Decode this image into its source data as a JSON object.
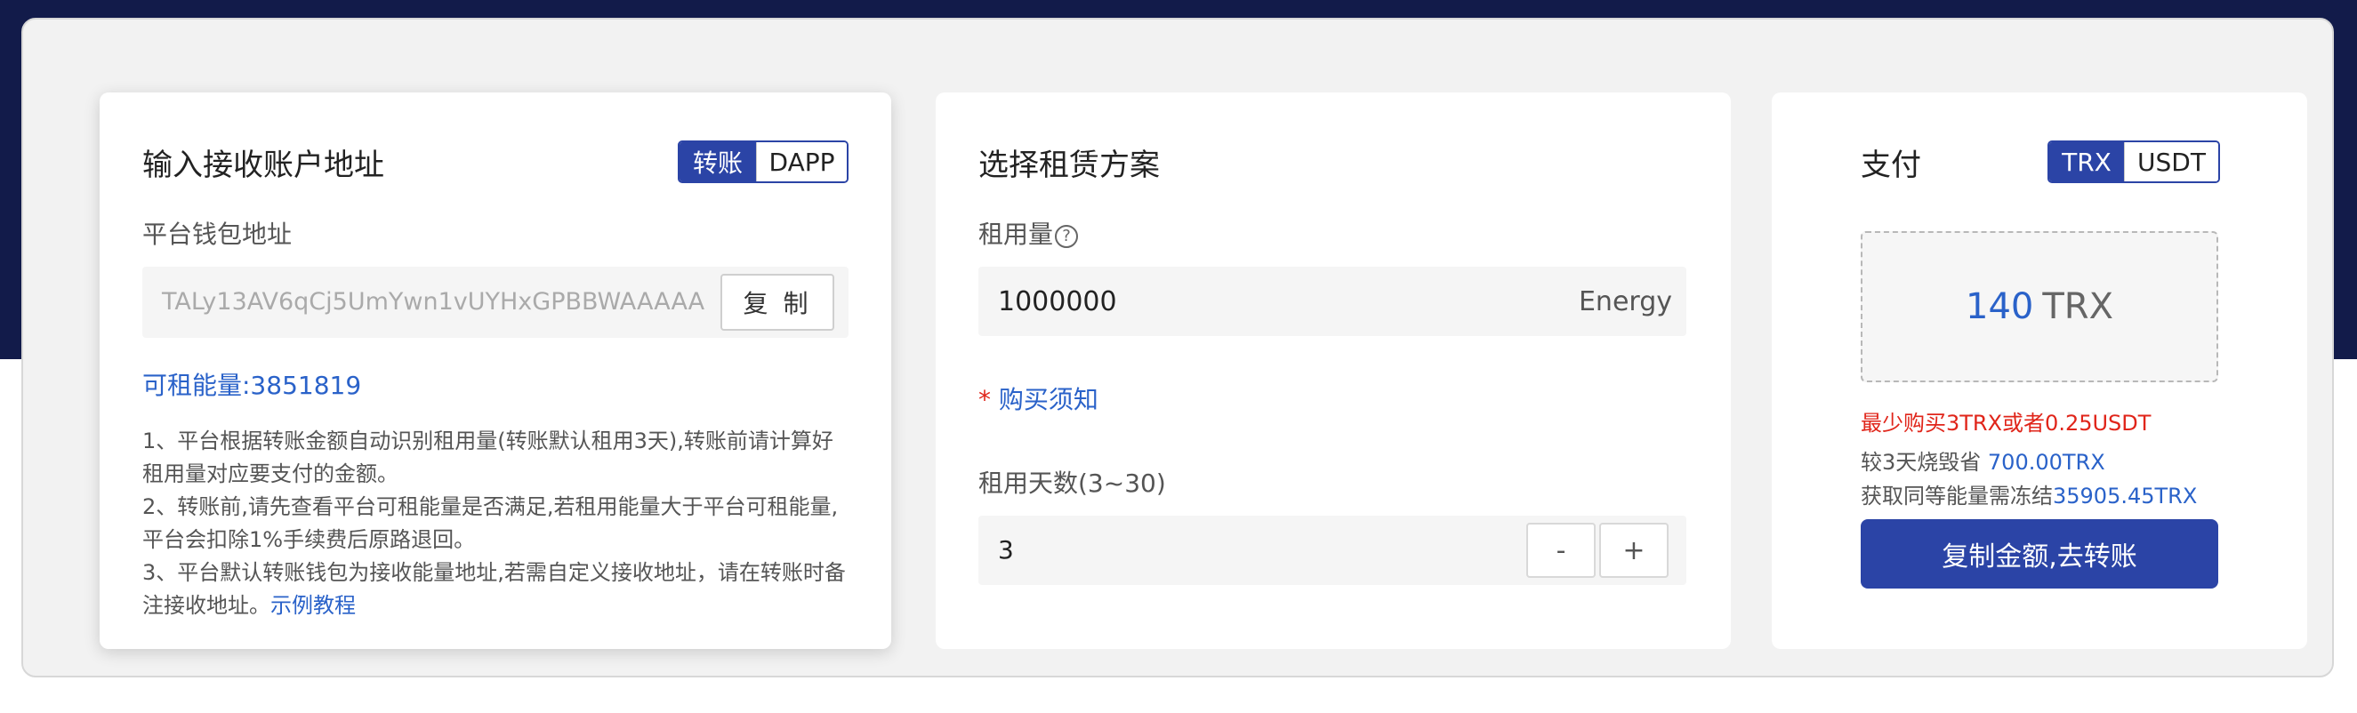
{
  "left": {
    "title": "输入接收账户地址",
    "tabs": [
      "转账",
      "DAPP"
    ],
    "wallet_label": "平台钱包地址",
    "wallet_address": "TALy13AV6qCj5UmYwn1vUYHxGPBBWAAAAA",
    "copy_label": "复 制",
    "available_energy": "可租能量:3851819",
    "notes": [
      "1、平台根据转账金额自动识别租用量(转账默认租用3天),转账前请计算好",
      "租用量对应要支付的金额。",
      "2、转账前,请先查看平台可租能量是否满足,若租用能量大于平台可租能量,",
      "平台会扣除1%手续费后原路退回。",
      "3、平台默认转账钱包为接收能量地址,若需自定义接收地址，请在转账时备",
      "注接收地址。"
    ],
    "tutorial_link": "示例教程"
  },
  "middle": {
    "title": "选择租赁方案",
    "amount_label": "租用量",
    "help_icon": "?",
    "amount_value": "1000000",
    "amount_unit": "Energy",
    "purchase_notice_star": "*",
    "purchase_notice": "购买须知",
    "days_label": "租用天数(3~30)",
    "days_value": "3",
    "minus": "-",
    "plus": "+"
  },
  "right": {
    "title": "支付",
    "currency_tabs": [
      "TRX",
      "USDT"
    ],
    "price_value": "140",
    "price_unit": "TRX",
    "min_purchase": "最少购买3TRX或者0.25USDT",
    "save_prefix": "较3天烧毁省 ",
    "save_value": "700.00TRX",
    "freeze_prefix": "获取同等能量需冻结",
    "freeze_value": "35905.45TRX",
    "pay_button": "复制金额,去转账"
  },
  "colors": {
    "header_bg": "#121b4a",
    "accent": "#2b44a6",
    "link": "#2a62c9",
    "warning": "#e0251a"
  }
}
